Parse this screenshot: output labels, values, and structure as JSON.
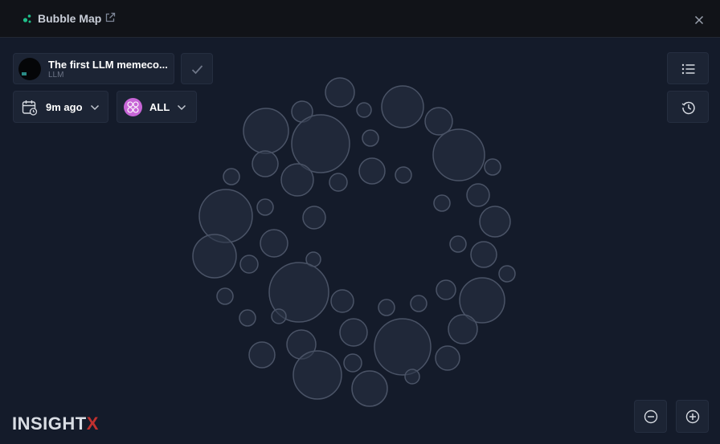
{
  "window": {
    "title": "Bubble Map",
    "colors": {
      "background": "#141b2a",
      "titlebar": "#111318",
      "panel": "#1c2434",
      "accent_green": "#1fc08a",
      "filter_badge": "#c765d6",
      "brand_x": "#c2312f"
    }
  },
  "token": {
    "name": "The first LLM memeco...",
    "symbol": "LLM"
  },
  "filters": {
    "time_label": "9m ago",
    "holder_filter_label": "ALL"
  },
  "icons": {
    "title": "bubble-dots-icon",
    "external": "external-link-icon",
    "close": "close-icon",
    "confirm": "check-icon",
    "calendar": "calendar-clock-icon",
    "chevron": "chevron-down-icon",
    "list": "list-icon",
    "history": "history-icon",
    "zoom_out": "zoom-out-icon",
    "zoom_in": "zoom-in-icon"
  },
  "brand": {
    "name_main": "INSIGHT",
    "name_suffix": "X"
  }
}
